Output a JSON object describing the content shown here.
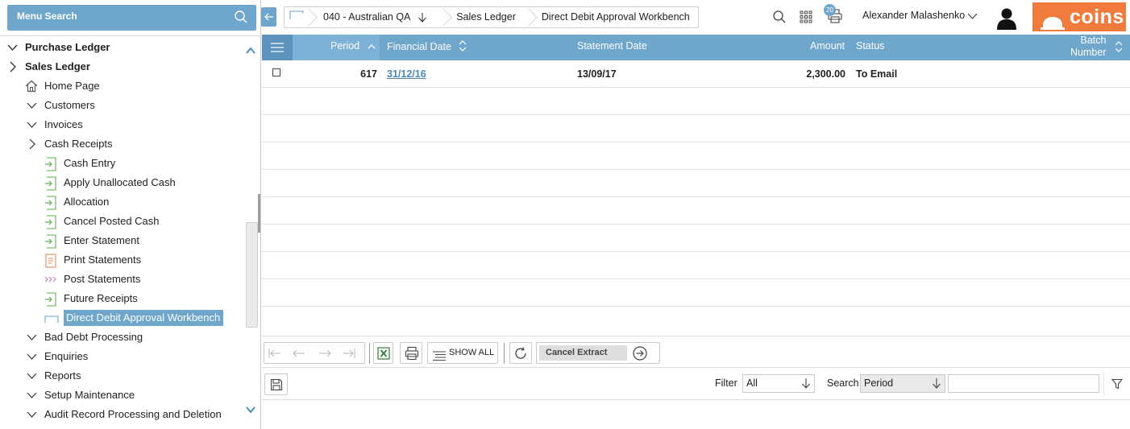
{
  "menu": {
    "search_label": "Menu Search",
    "items": [
      {
        "label": "Purchase Ledger"
      },
      {
        "label": "Sales Ledger"
      },
      {
        "label": "Home Page"
      },
      {
        "label": "Customers"
      },
      {
        "label": "Invoices"
      },
      {
        "label": "Cash Receipts"
      },
      {
        "label": "Cash Entry"
      },
      {
        "label": "Apply Unallocated Cash"
      },
      {
        "label": "Allocation"
      },
      {
        "label": "Cancel Posted Cash"
      },
      {
        "label": "Enter Statement"
      },
      {
        "label": "Print Statements"
      },
      {
        "label": "Post Statements"
      },
      {
        "label": "Future Receipts"
      },
      {
        "label": "Direct Debit Approval Workbench"
      },
      {
        "label": "Bad Debt Processing"
      },
      {
        "label": "Enquiries"
      },
      {
        "label": "Reports"
      },
      {
        "label": "Setup Maintenance"
      },
      {
        "label": "Audit Record Processing and Deletion"
      }
    ]
  },
  "breadcrumb": {
    "company": "040 - Australian QA",
    "module": "Sales Ledger",
    "page": "Direct Debit Approval Workbench"
  },
  "header": {
    "user_name": "Alexander Malashenko",
    "print_queue_count": "20",
    "logo_text": "coins",
    "logo_color": "#f07b3c",
    "accent_color": "#6fa6cc"
  },
  "grid": {
    "columns": {
      "period": "Period",
      "financial_date": "Financial Date",
      "statement_date": "Statement Date",
      "amount": "Amount",
      "status": "Status",
      "batch_line1": "Batch",
      "batch_line2": "Number"
    },
    "rows": [
      {
        "period": "617",
        "financial_date": "31/12/16",
        "statement_date": "13/09/17",
        "amount": "2,300.00",
        "status": "To Email",
        "batch": ""
      }
    ]
  },
  "toolbar": {
    "show_all_label": "SHOW ALL",
    "cancel_extract_label": "Cancel Extract"
  },
  "filterbar": {
    "filter_label": "Filter",
    "filter_value": "All",
    "search_label": "Search",
    "search_field_value": "Period",
    "search_input_value": ""
  }
}
